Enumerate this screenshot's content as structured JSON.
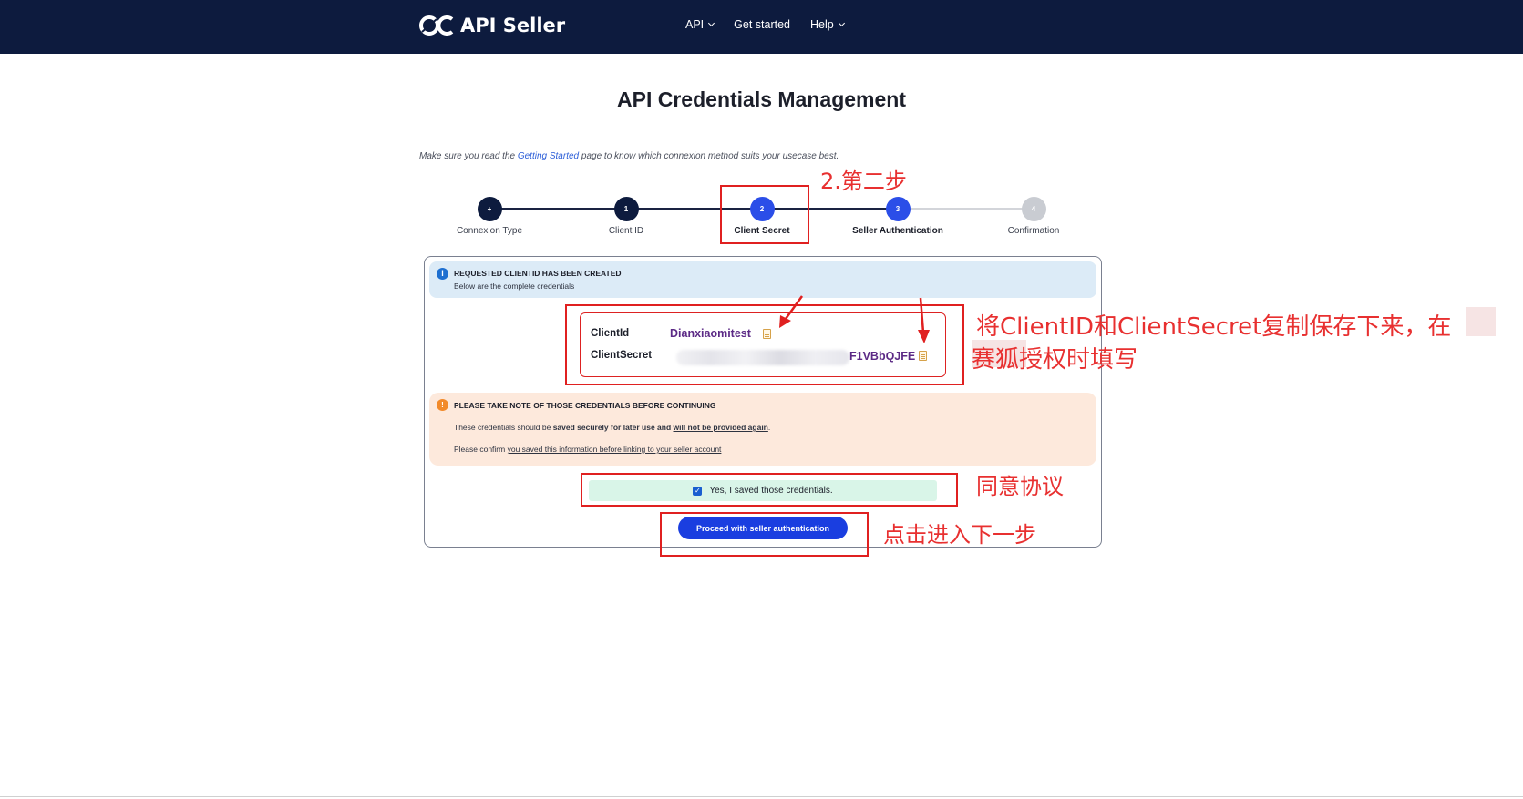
{
  "navbar": {
    "brand": "API Seller",
    "links": [
      {
        "label": "API",
        "dropdown": true
      },
      {
        "label": "Get started",
        "dropdown": false
      },
      {
        "label": "Help",
        "dropdown": true
      }
    ],
    "background": "#0d1b3e"
  },
  "page": {
    "title": "API Credentials Management",
    "intro_before": "Make sure you read the ",
    "intro_link": "Getting Started",
    "intro_after": " page to know which connexion method suits your usecase best."
  },
  "stepper": {
    "steps": [
      {
        "marker": "+",
        "label": "Connexion Type",
        "state": "done",
        "color": "#0d1b3e"
      },
      {
        "marker": "1",
        "label": "Client ID",
        "state": "done",
        "color": "#0d1b3e"
      },
      {
        "marker": "2",
        "label": "Client Secret",
        "state": "current",
        "color": "#2b4ee8"
      },
      {
        "marker": "3",
        "label": "Seller Authentication",
        "state": "next",
        "color": "#2b4ee8"
      },
      {
        "marker": "4",
        "label": "Confirmation",
        "state": "pending",
        "color": "#c9ccd2"
      }
    ]
  },
  "info_banner": {
    "icon": "info-icon",
    "title": "REQUESTED CLIENTID HAS BEEN CREATED",
    "subtitle": "Below are the complete credentials"
  },
  "credentials": {
    "client_id_label": "ClientId",
    "client_id_value": "Dianxiaomitest",
    "client_secret_label": "ClientSecret",
    "client_secret_visible": "F1VBbQJFE"
  },
  "warning_banner": {
    "icon": "warning-icon",
    "title": "PLEASE TAKE NOTE OF THOSE CREDENTIALS BEFORE CONTINUING",
    "line1_a": "These credentials should be ",
    "line1_b": "saved securely for later use and ",
    "line1_c": "will not be provided again",
    "line1_d": ".",
    "line2_a": "Please confirm ",
    "line2_b": "you saved this information before linking to your seller account"
  },
  "confirm": {
    "checked": true,
    "label": "Yes, I saved those credentials."
  },
  "proceed_button": "Proceed with seller authentication",
  "annotations": {
    "step2": "2.第二步",
    "copy_line1": "将ClientID和ClientSecret复制保存下来，在",
    "copy_line2": "赛狐授权时填写",
    "agree": "同意协议",
    "next": "点击进入下一步",
    "color": "#e02020"
  }
}
